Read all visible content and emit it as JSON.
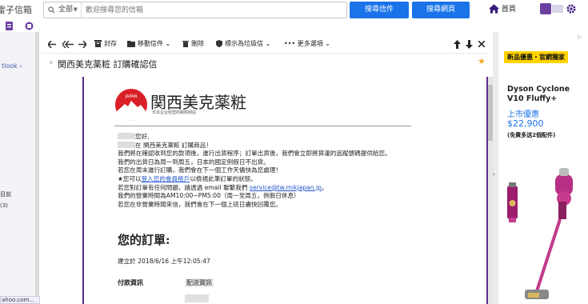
{
  "header": {
    "brand": "雷子信箱",
    "search_scope": "全部",
    "search_placeholder": "歡迎搜尋您的信箱",
    "search_mail_label": "搜尋信件",
    "search_web_label": "搜尋網頁",
    "home_label": "首頁"
  },
  "sidebar": {
    "outlook_label": "tlook",
    "folder_label": "目前",
    "folder_count": "(3)",
    "status_url": "ahoo.com..."
  },
  "toolbar": {
    "archive_label": "封存",
    "move_label": "移動信件",
    "delete_label": "刪除",
    "spam_label": "標示為垃圾信",
    "more_label": "更多選項"
  },
  "message": {
    "subject": "関西美克薬粧 訂購確認信",
    "brand_name": "関西美克薬粧",
    "brand_tagline": "日本企业经营的邮购网站",
    "brand_logo_text": "JAPAN",
    "greeting_suffix": "您好,",
    "line_thanks_suffix": "在 関西美克薬粧 訂購商品！",
    "line_1": "我們將在確認收到您的款項後，進行出貨程序；訂單出貨後，我們會立即將貨運的追蹤號碼提供給您。",
    "line_2": "我們的出貨日為周一到周五，日本的國定例假日不出貨。",
    "line_3": "若您在周末進行訂購，我們會在下一個工作天儘快為您處理！",
    "line_4_prefix": "★您可以",
    "line_4_link": "登入您的會員帳戶",
    "line_4_suffix": "以檢視此筆訂單的狀態。",
    "line_5_prefix": "若您對訂單有任何問題，請透過 email 聯繫我們 ",
    "line_5_email": "service@tw.mikjapan.jp",
    "line_5_suffix": "。",
    "line_6": "我們的營業時間為AM10:00~PM5:00（周一至周五，例假日休息）",
    "line_7": "若您在非營業時間來信，我們會在下一個上班日盡快回覆您。",
    "order_title": "您的訂單:",
    "created": "建立於 2018/6/16 上午12:05:47",
    "payment_heading": "付款資訊",
    "shipping_heading": "配送資訊"
  },
  "ad": {
    "adchoices": "▷",
    "badge": "新品優惠・官網獨家",
    "product": "Dyson Cyclone V10 Fluffy+",
    "launch": "上市優惠",
    "price": "$22,900",
    "note": "(免費多送2個配件)"
  },
  "colors": {
    "accent_blue": "#1a73e8",
    "frame_purple": "#5b2d8c",
    "brand_red": "#d92027",
    "badge_yellow": "#ffd400"
  }
}
